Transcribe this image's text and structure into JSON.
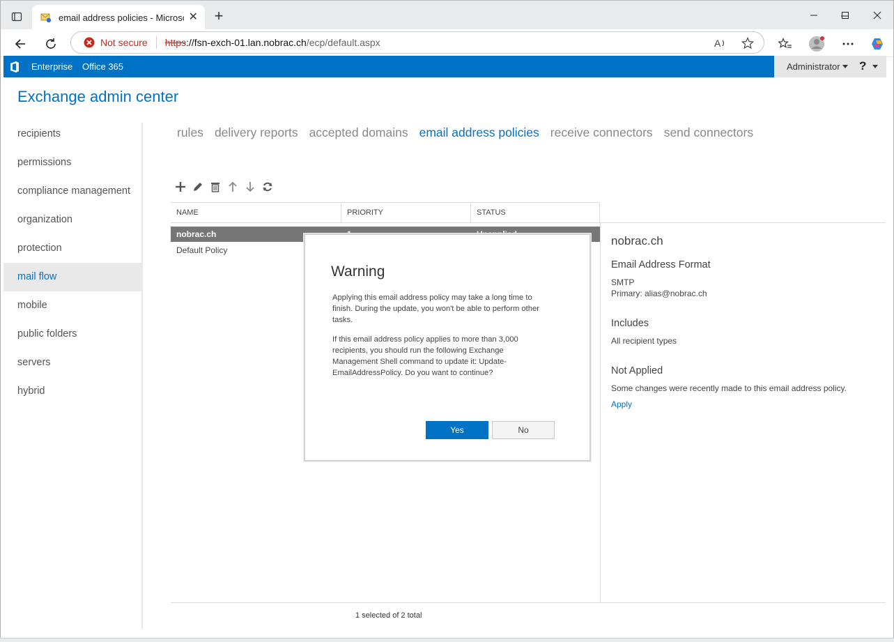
{
  "browser": {
    "tab_title": "email address policies - Microsoft",
    "security_label": "Not secure",
    "url_scheme": "https",
    "url_host": "://fsn-exch-01.lan.nobrac.ch",
    "url_path": "/ecp/default.aspx",
    "icons": [
      "tab-actions-icon",
      "favicon",
      "tab-close-icon",
      "new-tab-icon",
      "minimize-icon",
      "maximize-icon",
      "window-close-icon",
      "back-icon",
      "refresh-icon",
      "not-secure-icon",
      "read-aloud-icon",
      "favorite-star-icon",
      "favorites-icon",
      "profile-icon",
      "more-icon",
      "copilot-icon"
    ]
  },
  "eac": {
    "top_links": [
      "Enterprise",
      "Office 365"
    ],
    "user": "Administrator",
    "help_icon": "?",
    "title": "Exchange admin center",
    "nav": [
      "recipients",
      "permissions",
      "compliance management",
      "organization",
      "protection",
      "mail flow",
      "mobile",
      "public folders",
      "servers",
      "hybrid"
    ],
    "nav_active": "mail flow",
    "subtabs": [
      "rules",
      "delivery reports",
      "accepted domains",
      "email address policies",
      "receive connectors",
      "send connectors"
    ],
    "subtab_active": "email address policies",
    "toolbar_icons": [
      "add-icon",
      "edit-icon",
      "delete-icon",
      "move-up-icon",
      "move-down-icon",
      "refresh-icon"
    ]
  },
  "grid": {
    "columns": [
      "NAME",
      "PRIORITY",
      "STATUS"
    ],
    "rows": [
      {
        "name": "nobrac.ch",
        "priority": "1",
        "status": "Unapplied"
      },
      {
        "name": "Default Policy",
        "priority": "",
        "status": ""
      }
    ],
    "footer": "1 selected of 2 total"
  },
  "details": {
    "title": "nobrac.ch",
    "format_heading": "Email Address Format",
    "format_type": "SMTP",
    "format_primary": "Primary: alias@nobrac.ch",
    "includes_heading": "Includes",
    "includes_value": "All recipient types",
    "status_heading": "Not Applied",
    "status_text": "Some changes were recently made to this email address policy.",
    "apply_link": "Apply"
  },
  "dialog": {
    "title": "Warning",
    "paragraph1": "Applying this email address policy may take a long time to finish. During the update, you won't be able to perform other tasks.",
    "paragraph2": "If this email address policy applies to more than 3,000 recipients, you should run the following Exchange Management Shell command to update it: Update-EmailAddressPolicy. Do you want to continue?",
    "yes_label": "Yes",
    "no_label": "No"
  },
  "colors": {
    "accent": "#0072c6",
    "selected_row": "#767676",
    "not_secure": "#c42b1c"
  }
}
